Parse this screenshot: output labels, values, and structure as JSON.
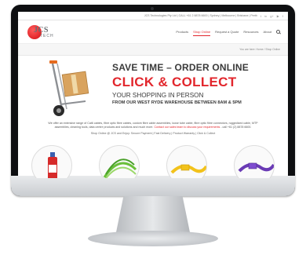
{
  "topbar": {
    "contact": "JCS Technologies Pty Ltd  |  CALL +61 2 8878 6600  |  Sydney  |  Melbourne  |  Brisbane  |  Perth",
    "social": [
      "twitter-icon",
      "linkedin-icon",
      "google-plus-icon",
      "youtube-icon",
      "facebook-icon"
    ]
  },
  "logo": {
    "main": "JCS",
    "sub": "TECH"
  },
  "nav": [
    {
      "label": "Products",
      "active": false
    },
    {
      "label": "Shop Online",
      "active": true
    },
    {
      "label": "Request a Quote",
      "active": false
    },
    {
      "label": "Resources",
      "active": false
    },
    {
      "label": "About",
      "active": false
    }
  ],
  "breadcrumb": "You are here: Home / Shop Online",
  "hero": {
    "line1": "SAVE TIME – ORDER ONLINE",
    "line2": "CLICK & COLLECT",
    "line3": "YOUR SHOPPING IN PERSON",
    "line4": "FROM OUR WEST RYDE WAREHOUSE BETWEEN 8AM & 5PM"
  },
  "intro": {
    "text": "We offer an extensive range of Cat6 cables, fibre optic fibre cables, custom fibre cable assemblies, loose tube cable, fibre optic fibre connectors, ruggedized cable, MTP assemblies, cleaning tools, data centre products and solutions and much more.",
    "link": "Contact our sales team to discuss your requirements",
    "phone": " - call +61 (2) 8878 6600."
  },
  "ticker": "Shop Online @ JCS and Enjoy: Secure Payment  |  Fast Delivery  |  Product Warranty  |  Click & Collect",
  "colors": {
    "brand_red": "#e2262c",
    "frame": "#0e0f11"
  }
}
